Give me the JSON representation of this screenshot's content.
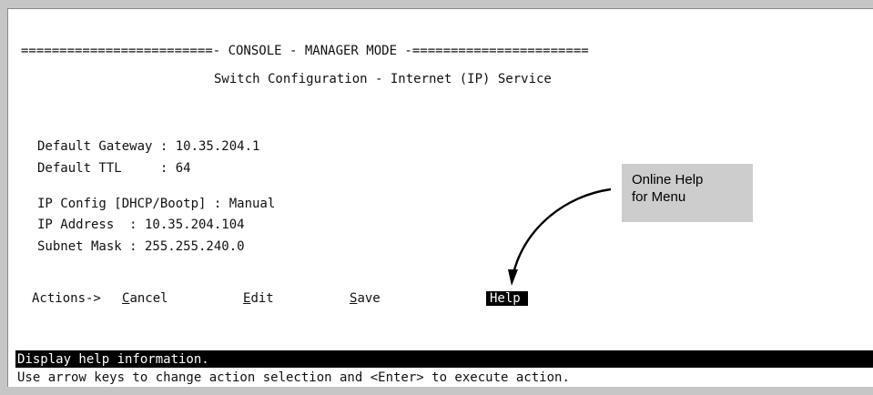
{
  "console": {
    "header_line": "=========================- CONSOLE - MANAGER MODE -=======================",
    "title": "Switch Configuration - Internet (IP) Service"
  },
  "fields": {
    "default_gateway": "Default Gateway : 10.35.204.1",
    "default_ttl": "Default TTL     : 64",
    "ip_config": "IP Config [DHCP/Bootp] : Manual",
    "ip_address": "IP Address  : 10.35.204.104",
    "subnet_mask": "Subnet Mask : 255.255.240.0"
  },
  "actions": {
    "prefix": "Actions->",
    "cancel": {
      "mnemonic": "C",
      "rest": "ancel"
    },
    "edit": {
      "mnemonic": "E",
      "rest": "dit"
    },
    "save": {
      "mnemonic": "S",
      "rest": "ave"
    },
    "help": "Help"
  },
  "status": {
    "message": "Display help information.",
    "hint": "Use arrow keys to change action selection and <Enter> to execute action."
  },
  "callout": {
    "line1": "Online Help",
    "line2": "for Menu"
  }
}
